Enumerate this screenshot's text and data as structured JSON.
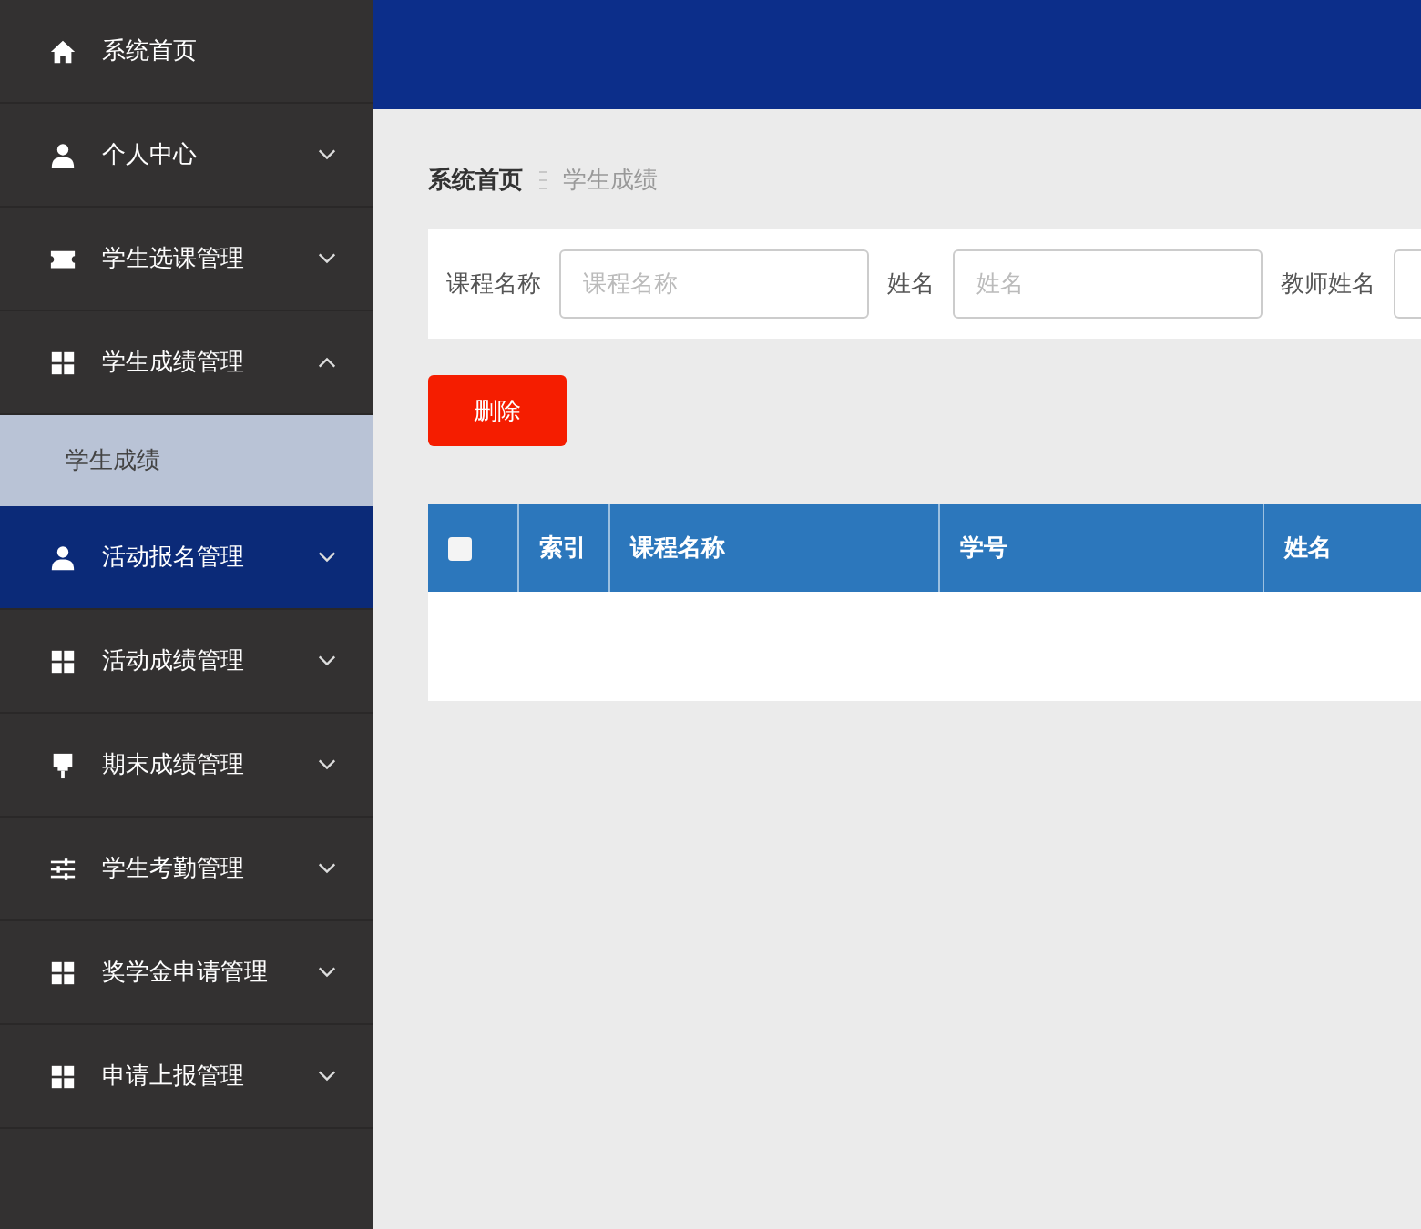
{
  "sidebar": {
    "items": [
      {
        "label": "系统首页",
        "kind": "link",
        "selected": false
      },
      {
        "label": "个人中心",
        "kind": "group",
        "expanded": false,
        "selected": false
      },
      {
        "label": "学生选课管理",
        "kind": "group",
        "expanded": false,
        "selected": false
      },
      {
        "label": "学生成绩管理",
        "kind": "group",
        "expanded": true,
        "selected": false,
        "children": [
          {
            "label": "学生成绩",
            "selected": true
          }
        ]
      },
      {
        "label": "活动报名管理",
        "kind": "group",
        "expanded": false,
        "selected": true
      },
      {
        "label": "活动成绩管理",
        "kind": "group",
        "expanded": false,
        "selected": false
      },
      {
        "label": "期末成绩管理",
        "kind": "group",
        "expanded": false,
        "selected": false
      },
      {
        "label": "学生考勤管理",
        "kind": "group",
        "expanded": false,
        "selected": false
      },
      {
        "label": "奖学金申请管理",
        "kind": "group",
        "expanded": false,
        "selected": false
      },
      {
        "label": "申请上报管理",
        "kind": "group",
        "expanded": false,
        "selected": false
      }
    ]
  },
  "breadcrumb": [
    "系统首页",
    "学生成绩"
  ],
  "search": {
    "fields": [
      {
        "label": "课程名称",
        "placeholder": "课程名称"
      },
      {
        "label": "姓名",
        "placeholder": "姓名"
      },
      {
        "label": "教师姓名"
      }
    ]
  },
  "actions": {
    "delete_button": "删除"
  },
  "table": {
    "select_all": {
      "checked": false
    },
    "columns": [
      "索引",
      "课程名称",
      "学号",
      "姓名"
    ]
  }
}
